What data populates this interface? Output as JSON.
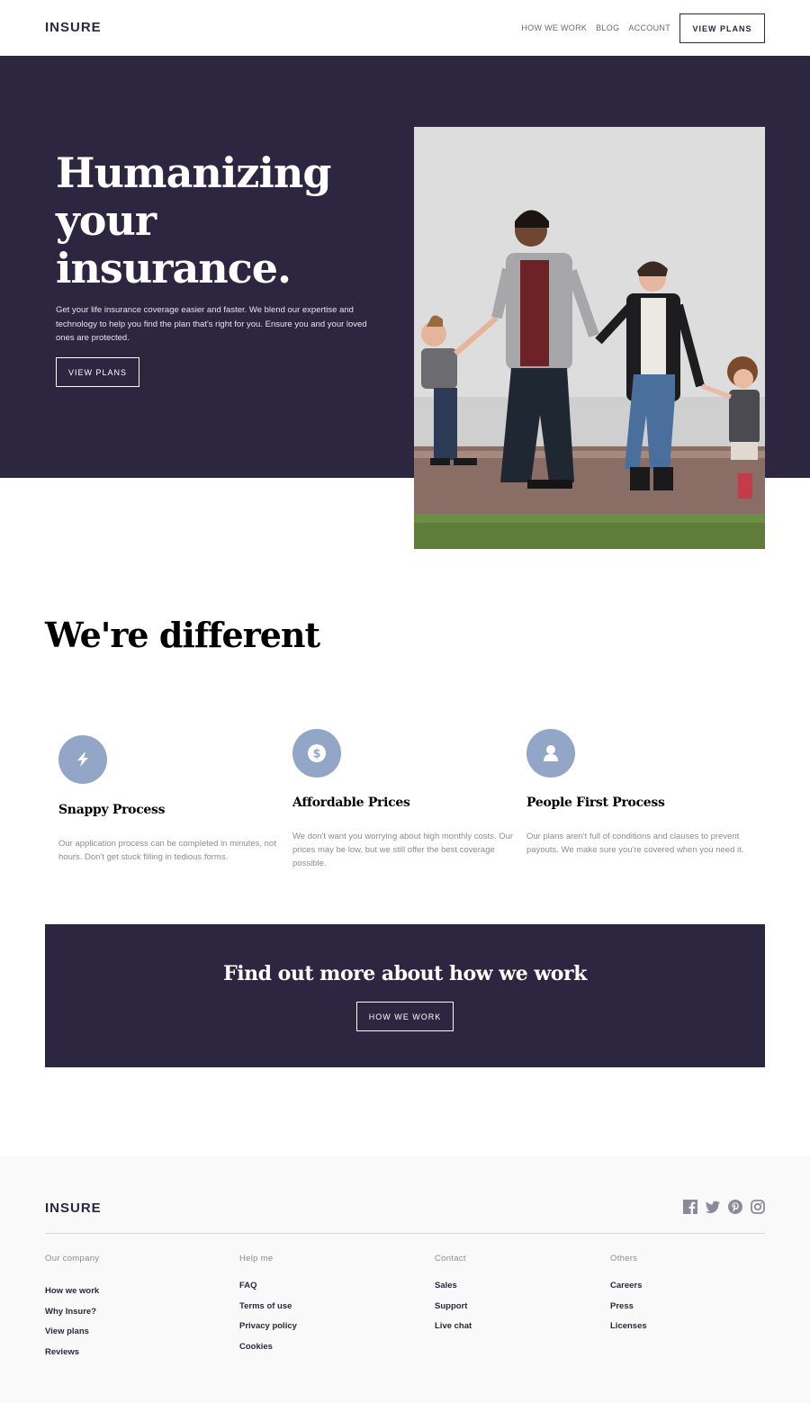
{
  "header": {
    "logo": "INSURE",
    "nav": [
      "HOW WE WORK",
      "BLOG",
      "ACCOUNT"
    ],
    "cta_label": "VIEW PLANS"
  },
  "hero": {
    "title": "Humanizing your insurance.",
    "text": "Get your life insurance coverage easier and faster. We blend our expertise and technology to help you find the plan that's right for you. Ensure you and your loved ones are protected.",
    "button_label": "VIEW PLANS"
  },
  "different": {
    "title": "We're different",
    "features": [
      {
        "icon": "lightning-icon",
        "title": "Snappy Process",
        "text": "Our application process can be completed in minutes, not hours. Don't get stuck filling in tedious forms."
      },
      {
        "icon": "dollar-icon",
        "title": "Affordable Prices",
        "text": "We don't want you worrying about high monthly costs. Our prices may be low, but we still offer the best coverage possible."
      },
      {
        "icon": "person-icon",
        "title": "People First Process",
        "text": "Our plans aren't full of conditions and clauses to prevent payouts. We make sure you're covered when you need it."
      }
    ]
  },
  "cta": {
    "title": "Find out more about how we work",
    "button_label": "HOW WE WORK"
  },
  "footer": {
    "logo": "INSURE",
    "social": [
      "facebook-icon",
      "twitter-icon",
      "pinterest-icon",
      "instagram-icon"
    ],
    "columns": [
      {
        "heading": "Our company",
        "links": [
          "How we work",
          "Why Insure?",
          "View plans",
          "Reviews"
        ]
      },
      {
        "heading": "Help me",
        "links": [
          "FAQ",
          "Terms of use",
          "Privacy policy",
          "Cookies"
        ]
      },
      {
        "heading": "Contact",
        "links": [
          "Sales",
          "Support",
          "Live chat"
        ]
      },
      {
        "heading": "Others",
        "links": [
          "Careers",
          "Press",
          "Licenses"
        ]
      }
    ]
  },
  "colors": {
    "dark_violet": "#2c2640",
    "icon_blue": "#93a6c7",
    "footer_bg": "#f9f9f9"
  }
}
